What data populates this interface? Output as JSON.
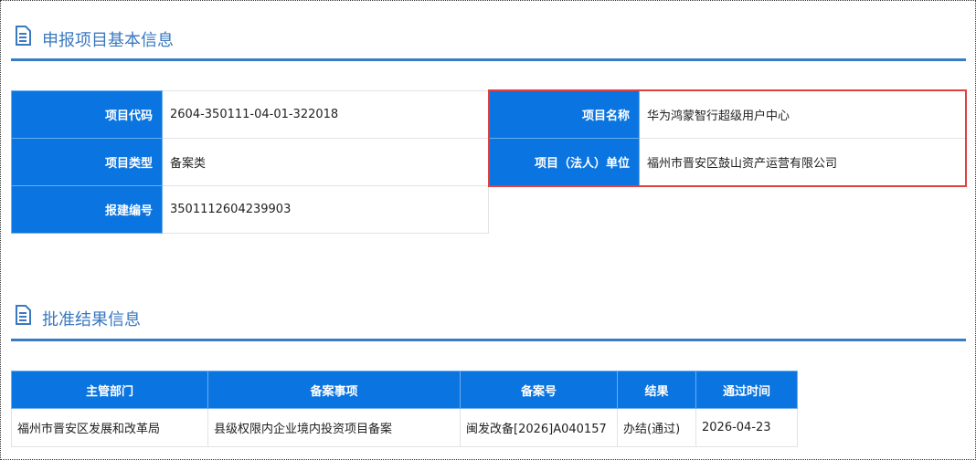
{
  "section1": {
    "title": "申报项目基本信息",
    "icon": "document-icon"
  },
  "basic_left": [
    {
      "label": "项目代码",
      "value": "2604-350111-04-01-322018"
    },
    {
      "label": "项目类型",
      "value": "备案类"
    },
    {
      "label": "报建编号",
      "value": "3501112604239903"
    }
  ],
  "basic_right": [
    {
      "label": "项目名称",
      "value": "华为鸿蒙智行超级用户中心"
    },
    {
      "label": "项目（法人）单位",
      "value": "福州市晋安区鼓山资产运营有限公司"
    }
  ],
  "section2": {
    "title": "批准结果信息",
    "icon": "document-icon"
  },
  "result_table": {
    "headers": [
      "主管部门",
      "备案事项",
      "备案号",
      "结果",
      "通过时间"
    ],
    "rows": [
      [
        "福州市晋安区发展和改革局",
        "县级权限内企业境内投资项目备案",
        "闽发改备[2026]A040157",
        "办结(通过)",
        "2026-04-23"
      ]
    ]
  }
}
